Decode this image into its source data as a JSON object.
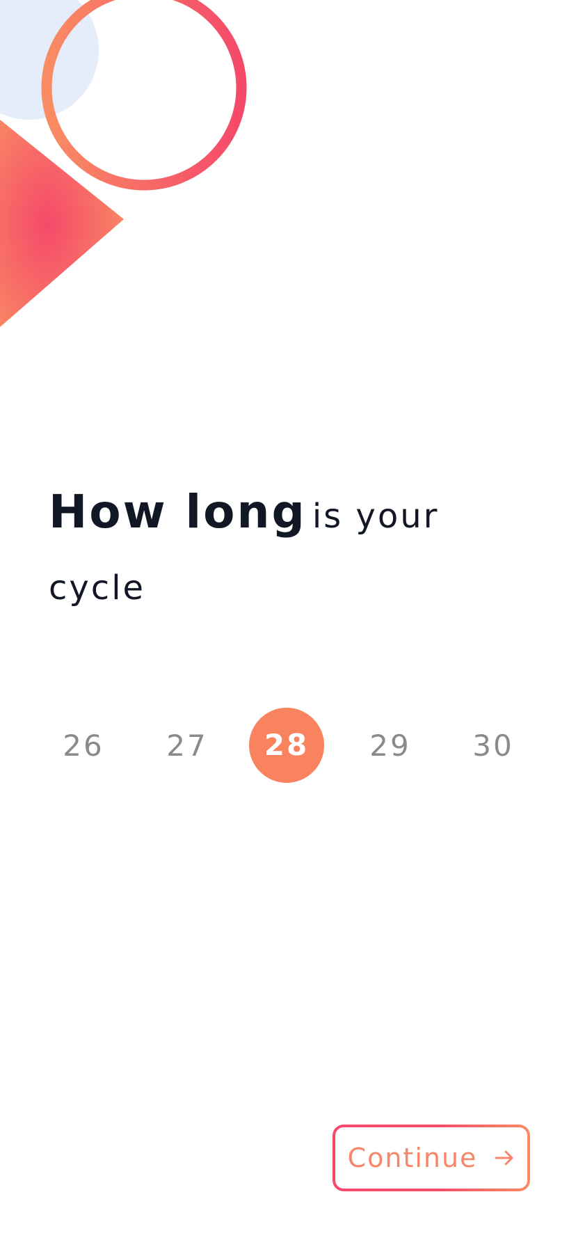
{
  "question": {
    "bold_text": "How long",
    "light_text": "is your cycle"
  },
  "cycle_picker": {
    "options": [
      "26",
      "27",
      "28",
      "29",
      "30"
    ],
    "selected": "28"
  },
  "continue_button": {
    "label": "Continue",
    "icon": "arrow-right-icon"
  },
  "colors": {
    "accent": "#f9835f",
    "gradient_start": "#f5496a",
    "gradient_end": "#f98c63",
    "decor_blue": "#e5ecfa",
    "text_dark": "#121726",
    "text_muted": "#8a8a8a"
  }
}
